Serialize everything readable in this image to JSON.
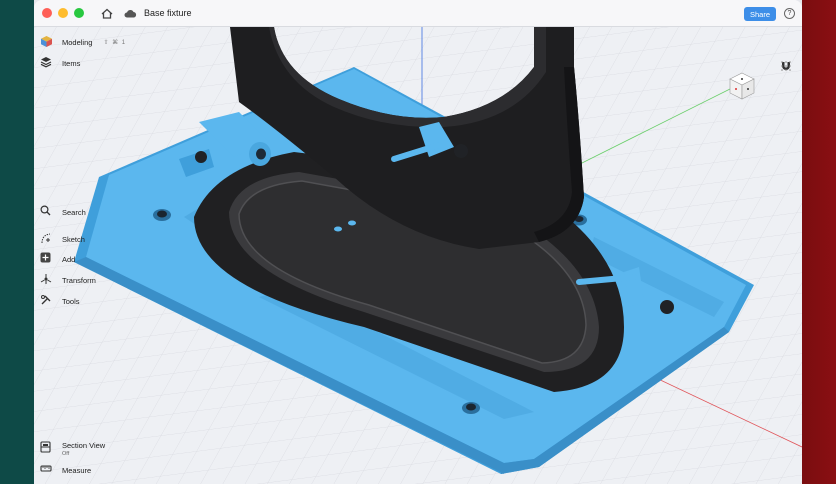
{
  "window": {
    "title": "Base fixture",
    "share_label": "Share",
    "help_glyph": "?"
  },
  "sidebar": {
    "modeling_label": "Modeling",
    "modeling_shortcut": "⇧ ⌘ 1",
    "items_label": "Items"
  },
  "tools": {
    "search_label": "Search",
    "sketch_label": "Sketch",
    "add_label": "Add",
    "transform_label": "Transform",
    "tools_label": "Tools"
  },
  "bottom": {
    "section_view_label": "Section View",
    "section_view_state": "Off",
    "measure_label": "Measure"
  },
  "icons": {
    "home": "home-icon",
    "cloud": "cloud-icon",
    "cube": "cube-icon",
    "layers": "layers-icon",
    "search": "search-icon",
    "sketch": "sketch-icon",
    "add": "plus-icon",
    "transform": "transform-icon",
    "tools": "tools-icon",
    "section": "section-view-icon",
    "measure": "measure-icon",
    "magnet": "magnet-icon",
    "grid": "grid-icon"
  },
  "colors": {
    "part_blue": "#5bb7ee",
    "dark_part": "#2f2f31",
    "share_button": "#3d8ee8",
    "z_axis": "#3b6fe0",
    "x_axis": "#e0555a",
    "y_axis": "#6bcf6b"
  }
}
